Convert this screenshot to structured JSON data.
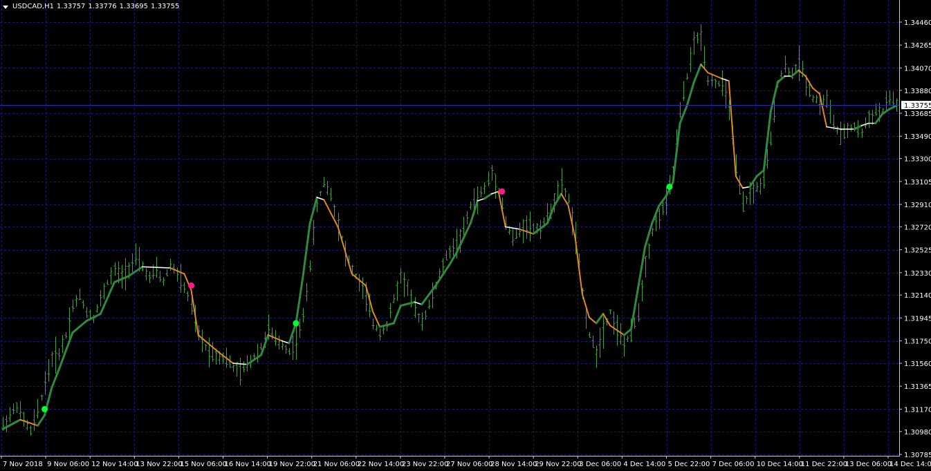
{
  "header": {
    "symbol_timeframe": "USDCAD,H1",
    "open": "1.33757",
    "high": "1.33776",
    "low": "1.33695",
    "close": "1.33755"
  },
  "price_axis": {
    "labels": [
      "1.34460",
      "1.34265",
      "1.34070",
      "1.33880",
      "1.33685",
      "1.33490",
      "1.33300",
      "1.33105",
      "1.32910",
      "1.32720",
      "1.32525",
      "1.32330",
      "1.32140",
      "1.31945",
      "1.31750",
      "1.31560",
      "1.31365",
      "1.31170",
      "1.30980",
      "1.30785"
    ],
    "current_price_label": "1.33755"
  },
  "time_axis": {
    "labels": [
      "7 Nov 2018",
      "9 Nov 06:00",
      "12 Nov 14:00",
      "13 Nov 22:00",
      "15 Nov 06:00",
      "16 Nov 14:00",
      "19 Nov 22:00",
      "21 Nov 06:00",
      "22 Nov 14:00",
      "23 Nov 22:00",
      "27 Nov 06:00",
      "28 Nov 14:00",
      "29 Nov 22:00",
      "3 Dec 06:00",
      "4 Dec 14:00",
      "5 Dec 22:00",
      "7 Dec 06:00",
      "10 Dec 14:00",
      "11 Dec 22:00",
      "13 Dec 06:00",
      "14 Dec 14:00"
    ]
  },
  "colors": {
    "background": "#000000",
    "grid": "#1a1a66",
    "bars": "#3fa23a",
    "ma_up": "#2e8b3d",
    "ma_flat": "#ffffff",
    "ma_down": "#e08a1e",
    "signal_buy": "#00ff33",
    "signal_sell": "#ff1a8c",
    "text": "#ffffff"
  },
  "chart_data": {
    "type": "line",
    "symbol": "USDCAD",
    "timeframe": "H1",
    "ylim": [
      1.30785,
      1.3465
    ],
    "y_ticks": [
      1.3446,
      1.34265,
      1.3407,
      1.3388,
      1.33685,
      1.3349,
      1.333,
      1.33105,
      1.3291,
      1.3272,
      1.32525,
      1.3233,
      1.3214,
      1.31945,
      1.3175,
      1.3156,
      1.31365,
      1.3117,
      1.3098,
      1.30785
    ],
    "x_tick_labels": [
      "7 Nov 2018",
      "9 Nov 06:00",
      "12 Nov 14:00",
      "13 Nov 22:00",
      "15 Nov 06:00",
      "16 Nov 14:00",
      "19 Nov 22:00",
      "21 Nov 06:00",
      "22 Nov 14:00",
      "23 Nov 22:00",
      "27 Nov 06:00",
      "28 Nov 14:00",
      "29 Nov 22:00",
      "3 Dec 06:00",
      "4 Dec 14:00",
      "5 Dec 22:00",
      "7 Dec 06:00",
      "10 Dec 14:00",
      "11 Dec 22:00",
      "13 Dec 06:00",
      "14 Dec 14:00"
    ],
    "last_price": 1.33755,
    "grid": true,
    "price_line": [
      [
        0,
        1.3103
      ],
      [
        2,
        1.3112
      ],
      [
        4,
        1.312
      ],
      [
        6,
        1.3108
      ],
      [
        8,
        1.3098
      ],
      [
        10,
        1.3115
      ],
      [
        12,
        1.314
      ],
      [
        14,
        1.316
      ],
      [
        16,
        1.3165
      ],
      [
        18,
        1.318
      ],
      [
        20,
        1.3205
      ],
      [
        22,
        1.3213
      ],
      [
        24,
        1.32
      ],
      [
        26,
        1.3195
      ],
      [
        28,
        1.321
      ],
      [
        30,
        1.3225
      ],
      [
        32,
        1.3235
      ],
      [
        34,
        1.323
      ],
      [
        36,
        1.3238
      ],
      [
        38,
        1.3245
      ],
      [
        40,
        1.3238
      ],
      [
        42,
        1.3228
      ],
      [
        44,
        1.3235
      ],
      [
        46,
        1.3225
      ],
      [
        48,
        1.324
      ],
      [
        50,
        1.3232
      ],
      [
        52,
        1.322
      ],
      [
        54,
        1.3205
      ],
      [
        56,
        1.318
      ],
      [
        58,
        1.317
      ],
      [
        60,
        1.3165
      ],
      [
        62,
        1.3162
      ],
      [
        64,
        1.316
      ],
      [
        66,
        1.3152
      ],
      [
        68,
        1.3148
      ],
      [
        70,
        1.3155
      ],
      [
        72,
        1.3162
      ],
      [
        74,
        1.317
      ],
      [
        76,
        1.3185
      ],
      [
        78,
        1.3175
      ],
      [
        80,
        1.3172
      ],
      [
        82,
        1.3166
      ],
      [
        84,
        1.3175
      ],
      [
        86,
        1.3195
      ],
      [
        88,
        1.324
      ],
      [
        90,
        1.329
      ],
      [
        92,
        1.331
      ],
      [
        94,
        1.33
      ],
      [
        96,
        1.3275
      ],
      [
        98,
        1.325
      ],
      [
        100,
        1.3235
      ],
      [
        102,
        1.3225
      ],
      [
        104,
        1.3212
      ],
      [
        106,
        1.319
      ],
      [
        108,
        1.3182
      ],
      [
        110,
        1.3188
      ],
      [
        112,
        1.321
      ],
      [
        114,
        1.323
      ],
      [
        116,
        1.322
      ],
      [
        118,
        1.32
      ],
      [
        120,
        1.3192
      ],
      [
        122,
        1.3205
      ],
      [
        124,
        1.3222
      ],
      [
        126,
        1.324
      ],
      [
        128,
        1.3252
      ],
      [
        130,
        1.3258
      ],
      [
        132,
        1.3268
      ],
      [
        134,
        1.329
      ],
      [
        136,
        1.3296
      ],
      [
        138,
        1.3305
      ],
      [
        140,
        1.3318
      ],
      [
        142,
        1.3303
      ],
      [
        144,
        1.3275
      ],
      [
        146,
        1.3262
      ],
      [
        148,
        1.3268
      ],
      [
        150,
        1.3275
      ],
      [
        152,
        1.327
      ],
      [
        154,
        1.3272
      ],
      [
        156,
        1.328
      ],
      [
        158,
        1.3295
      ],
      [
        160,
        1.3308
      ],
      [
        162,
        1.3295
      ],
      [
        164,
        1.3262
      ],
      [
        166,
        1.3215
      ],
      [
        168,
        1.318
      ],
      [
        170,
        1.3165
      ],
      [
        172,
        1.3185
      ],
      [
        174,
        1.32
      ],
      [
        176,
        1.3185
      ],
      [
        178,
        1.3172
      ],
      [
        180,
        1.318
      ],
      [
        182,
        1.32
      ],
      [
        184,
        1.324
      ],
      [
        186,
        1.3268
      ],
      [
        188,
        1.3282
      ],
      [
        190,
        1.3292
      ],
      [
        192,
        1.332
      ],
      [
        194,
        1.337
      ],
      [
        196,
        1.34
      ],
      [
        198,
        1.3428
      ],
      [
        200,
        1.3435
      ],
      [
        202,
        1.3398
      ],
      [
        204,
        1.3395
      ],
      [
        206,
        1.3392
      ],
      [
        208,
        1.3375
      ],
      [
        210,
        1.332
      ],
      [
        212,
        1.329
      ],
      [
        214,
        1.33
      ],
      [
        216,
        1.3305
      ],
      [
        218,
        1.331
      ],
      [
        220,
        1.3345
      ],
      [
        222,
        1.3395
      ],
      [
        224,
        1.3408
      ],
      [
        226,
        1.3402
      ],
      [
        228,
        1.3412
      ],
      [
        230,
        1.3396
      ],
      [
        232,
        1.3382
      ],
      [
        234,
        1.3378
      ],
      [
        236,
        1.338
      ],
      [
        238,
        1.336
      ],
      [
        240,
        1.3348
      ],
      [
        242,
        1.3355
      ],
      [
        244,
        1.3357
      ],
      [
        246,
        1.3352
      ],
      [
        248,
        1.3365
      ],
      [
        250,
        1.337
      ],
      [
        252,
        1.337
      ],
      [
        254,
        1.3382
      ],
      [
        256,
        1.3376
      ]
    ],
    "moving_average": [
      [
        0,
        1.31
      ],
      [
        5,
        1.3108
      ],
      [
        10,
        1.3103
      ],
      [
        12,
        1.3112
      ],
      [
        14,
        1.3135
      ],
      [
        16,
        1.315
      ],
      [
        20,
        1.3182
      ],
      [
        24,
        1.3192
      ],
      [
        28,
        1.3198
      ],
      [
        32,
        1.3225
      ],
      [
        36,
        1.323
      ],
      [
        40,
        1.3238
      ],
      [
        48,
        1.3237
      ],
      [
        52,
        1.3232
      ],
      [
        54,
        1.3218
      ],
      [
        56,
        1.318
      ],
      [
        60,
        1.317
      ],
      [
        62,
        1.3165
      ],
      [
        66,
        1.3156
      ],
      [
        70,
        1.3155
      ],
      [
        74,
        1.3163
      ],
      [
        76,
        1.318
      ],
      [
        80,
        1.3175
      ],
      [
        82,
        1.3173
      ],
      [
        84,
        1.319
      ],
      [
        86,
        1.323
      ],
      [
        88,
        1.3275
      ],
      [
        90,
        1.3297
      ],
      [
        92,
        1.3295
      ],
      [
        96,
        1.3272
      ],
      [
        100,
        1.3232
      ],
      [
        104,
        1.3222
      ],
      [
        106,
        1.32
      ],
      [
        108,
        1.3187
      ],
      [
        112,
        1.319
      ],
      [
        114,
        1.3205
      ],
      [
        118,
        1.3208
      ],
      [
        120,
        1.3206
      ],
      [
        124,
        1.3222
      ],
      [
        128,
        1.324
      ],
      [
        130,
        1.325
      ],
      [
        134,
        1.3275
      ],
      [
        136,
        1.3294
      ],
      [
        138,
        1.3296
      ],
      [
        140,
        1.33
      ],
      [
        142,
        1.3302
      ],
      [
        144,
        1.3272
      ],
      [
        148,
        1.327
      ],
      [
        152,
        1.3266
      ],
      [
        156,
        1.3275
      ],
      [
        158,
        1.329
      ],
      [
        160,
        1.33
      ],
      [
        162,
        1.329
      ],
      [
        164,
        1.3262
      ],
      [
        166,
        1.3215
      ],
      [
        168,
        1.3195
      ],
      [
        170,
        1.319
      ],
      [
        172,
        1.3198
      ],
      [
        174,
        1.3188
      ],
      [
        178,
        1.318
      ],
      [
        180,
        1.3185
      ],
      [
        184,
        1.3255
      ],
      [
        186,
        1.3275
      ],
      [
        188,
        1.329
      ],
      [
        190,
        1.3298
      ],
      [
        192,
        1.331
      ],
      [
        194,
        1.336
      ],
      [
        196,
        1.3375
      ],
      [
        198,
        1.3395
      ],
      [
        200,
        1.341
      ],
      [
        202,
        1.3403
      ],
      [
        206,
        1.3398
      ],
      [
        208,
        1.3396
      ],
      [
        210,
        1.3315
      ],
      [
        212,
        1.3305
      ],
      [
        214,
        1.3306
      ],
      [
        216,
        1.3315
      ],
      [
        218,
        1.332
      ],
      [
        220,
        1.337
      ],
      [
        222,
        1.3395
      ],
      [
        224,
        1.34
      ],
      [
        226,
        1.34
      ],
      [
        228,
        1.3405
      ],
      [
        230,
        1.34
      ],
      [
        232,
        1.339
      ],
      [
        234,
        1.3385
      ],
      [
        236,
        1.3357
      ],
      [
        240,
        1.3355
      ],
      [
        244,
        1.3355
      ],
      [
        246,
        1.3358
      ],
      [
        248,
        1.336
      ],
      [
        250,
        1.336
      ],
      [
        252,
        1.3368
      ],
      [
        254,
        1.3372
      ],
      [
        256,
        1.3375
      ]
    ],
    "signals": [
      {
        "type": "buy",
        "x": 12,
        "y": 1.3117
      },
      {
        "type": "sell",
        "x": 54,
        "y": 1.3222
      },
      {
        "type": "buy",
        "x": 84,
        "y": 1.319
      },
      {
        "type": "sell",
        "x": 143,
        "y": 1.3302
      },
      {
        "type": "buy",
        "x": 191,
        "y": 1.3306
      }
    ]
  }
}
